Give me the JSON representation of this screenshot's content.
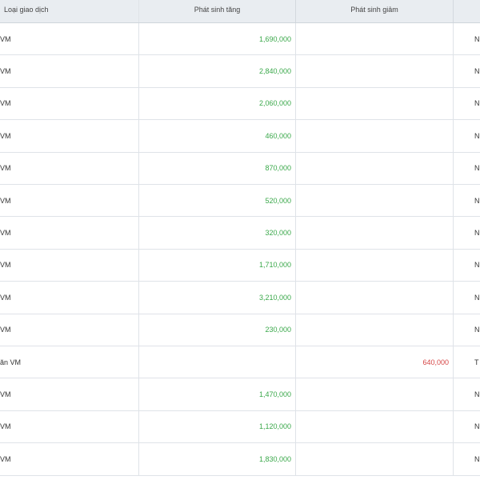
{
  "table": {
    "headers": {
      "transaction_type": "Loại giao dịch",
      "increase": "Phát sinh tăng",
      "decrease": "Phát sinh giảm"
    },
    "rows": [
      {
        "type": "VM",
        "increase": "1,690,000",
        "decrease": "",
        "status": "N"
      },
      {
        "type": "VM",
        "increase": "2,840,000",
        "decrease": "",
        "status": "N"
      },
      {
        "type": "VM",
        "increase": "2,060,000",
        "decrease": "",
        "status": "N"
      },
      {
        "type": "VM",
        "increase": "460,000",
        "decrease": "",
        "status": "N"
      },
      {
        "type": "VM",
        "increase": "870,000",
        "decrease": "",
        "status": "N"
      },
      {
        "type": "VM",
        "increase": "520,000",
        "decrease": "",
        "status": "N"
      },
      {
        "type": "VM",
        "increase": "320,000",
        "decrease": "",
        "status": "N"
      },
      {
        "type": "VM",
        "increase": "1,710,000",
        "decrease": "",
        "status": "N"
      },
      {
        "type": "VM",
        "increase": "3,210,000",
        "decrease": "",
        "status": "N"
      },
      {
        "type": "VM",
        "increase": "230,000",
        "decrease": "",
        "status": "N"
      },
      {
        "type": "ăn VM",
        "increase": "",
        "decrease": "640,000",
        "status": "T"
      },
      {
        "type": "VM",
        "increase": "1,470,000",
        "decrease": "",
        "status": "N"
      },
      {
        "type": "VM",
        "increase": "1,120,000",
        "decrease": "",
        "status": "N"
      },
      {
        "type": "VM",
        "increase": "1,830,000",
        "decrease": "",
        "status": "N"
      }
    ]
  },
  "colors": {
    "increase": "#3aa84a",
    "decrease": "#d64545",
    "header_bg": "#e9edf1"
  }
}
